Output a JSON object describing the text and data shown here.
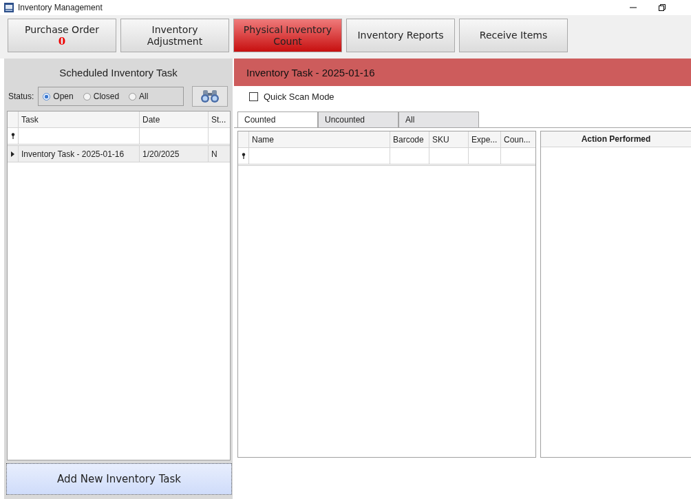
{
  "window": {
    "title": "Inventory Management"
  },
  "nav_buttons": [
    {
      "label": "Purchase Order",
      "badge": "0",
      "selected": false
    },
    {
      "label": "Inventory Adjustment",
      "selected": false
    },
    {
      "label": "Physical Inventory Count",
      "selected": true
    },
    {
      "label": "Inventory Reports",
      "selected": false
    },
    {
      "label": "Receive Items",
      "selected": false
    }
  ],
  "left_panel": {
    "title": "Scheduled Inventory Task",
    "status_label": "Status:",
    "status_options": [
      {
        "label": "Open",
        "selected": true
      },
      {
        "label": "Closed",
        "selected": false
      },
      {
        "label": "All",
        "selected": false
      }
    ],
    "table": {
      "columns": [
        "Task",
        "Date",
        "St..."
      ],
      "rows": [
        {
          "cells": [
            "Inventory Task - 2025-01-16",
            "1/20/2025",
            "N"
          ],
          "focused": true
        }
      ]
    },
    "add_button": "Add New Inventory Task"
  },
  "task_panel": {
    "title": "Inventory Task - 2025-01-16",
    "quick_scan": {
      "label": "Quick Scan Mode",
      "checked": false
    },
    "tabs": [
      {
        "label": "Counted",
        "selected": true
      },
      {
        "label": "Uncounted",
        "selected": false
      },
      {
        "label": "All",
        "selected": false
      }
    ],
    "items_table": {
      "columns": [
        "Name",
        "Barcode",
        "SKU",
        "Expe...",
        "Coun..."
      ]
    },
    "action_panel": {
      "title": "Action Performed"
    }
  }
}
